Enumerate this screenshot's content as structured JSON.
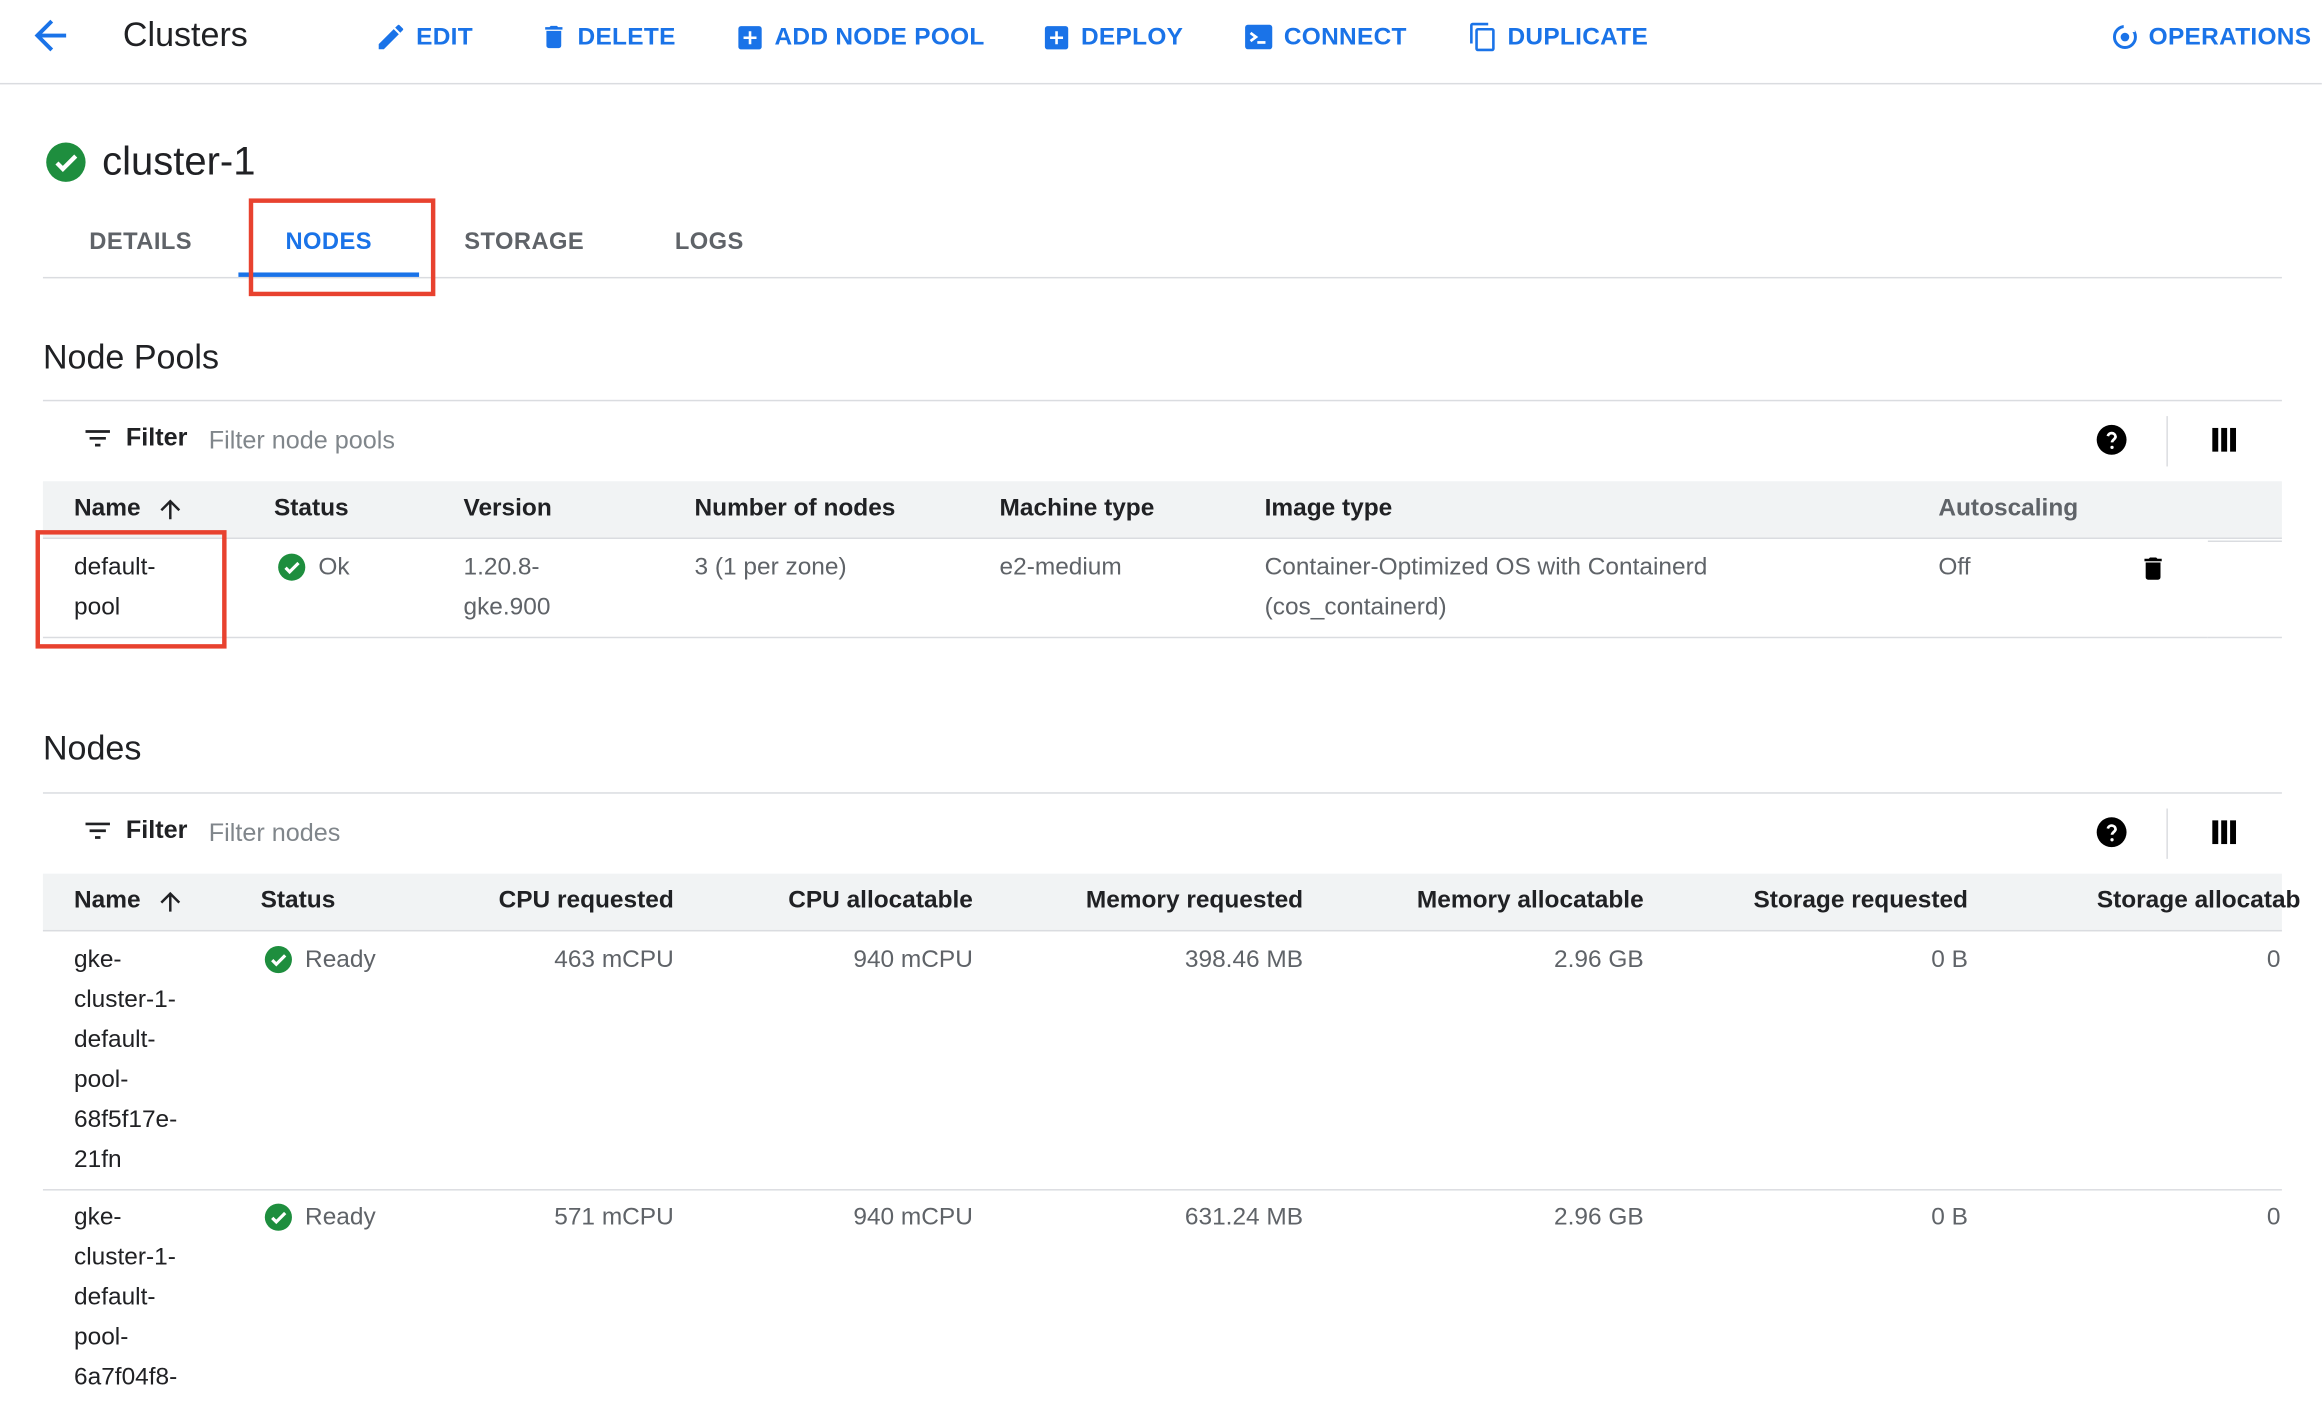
{
  "toolbar": {
    "title": "Clusters",
    "buttons": {
      "edit": "EDIT",
      "delete": "DELETE",
      "add_node_pool": "ADD NODE POOL",
      "deploy": "DEPLOY",
      "connect": "CONNECT",
      "duplicate": "DUPLICATE",
      "operations": "OPERATIONS"
    }
  },
  "cluster": {
    "name": "cluster-1",
    "status_icon": "check-circle-icon"
  },
  "tabs": {
    "details": "DETAILS",
    "nodes": "NODES",
    "storage": "STORAGE",
    "logs": "LOGS",
    "active": "NODES"
  },
  "node_pools": {
    "title": "Node Pools",
    "filter_label": "Filter",
    "filter_placeholder": "Filter node pools",
    "columns": {
      "name": "Name",
      "status": "Status",
      "version": "Version",
      "num_nodes": "Number of nodes",
      "machine_type": "Machine type",
      "image_type": "Image type",
      "autoscaling": "Autoscaling"
    },
    "rows": [
      {
        "name_line1": "default-",
        "name_line2": "pool",
        "status": "Ok",
        "version_line1": "1.20.8-",
        "version_line2": "gke.900",
        "num_nodes": "3 (1 per zone)",
        "machine_type": "e2-medium",
        "image_type_line1": "Container-Optimized OS with Containerd",
        "image_type_line2": "(cos_containerd)",
        "autoscaling": "Off"
      }
    ]
  },
  "nodes": {
    "title": "Nodes",
    "filter_label": "Filter",
    "filter_placeholder": "Filter nodes",
    "columns": {
      "name": "Name",
      "status": "Status",
      "cpu_requested": "CPU requested",
      "cpu_allocatable": "CPU allocatable",
      "memory_requested": "Memory requested",
      "memory_allocatable": "Memory allocatable",
      "storage_requested": "Storage requested",
      "storage_allocatable": "Storage allocatab"
    },
    "rows": [
      {
        "name_lines": [
          "gke-",
          "cluster-1-",
          "default-",
          "pool-",
          "68f5f17e-",
          "21fn"
        ],
        "status": "Ready",
        "cpu_requested": "463 mCPU",
        "cpu_allocatable": "940 mCPU",
        "memory_requested": "398.46 MB",
        "memory_allocatable": "2.96 GB",
        "storage_requested": "0 B",
        "storage_allocatable": "0"
      },
      {
        "name_lines": [
          "gke-",
          "cluster-1-",
          "default-",
          "pool-",
          "6a7f04f8-"
        ],
        "status": "Ready",
        "cpu_requested": "571 mCPU",
        "cpu_allocatable": "940 mCPU",
        "memory_requested": "631.24 MB",
        "memory_allocatable": "2.96 GB",
        "storage_requested": "0 B",
        "storage_allocatable": "0"
      }
    ]
  },
  "colors": {
    "accent": "#1a73e8",
    "success": "#1e8e3e",
    "highlight": "#e8422f"
  }
}
